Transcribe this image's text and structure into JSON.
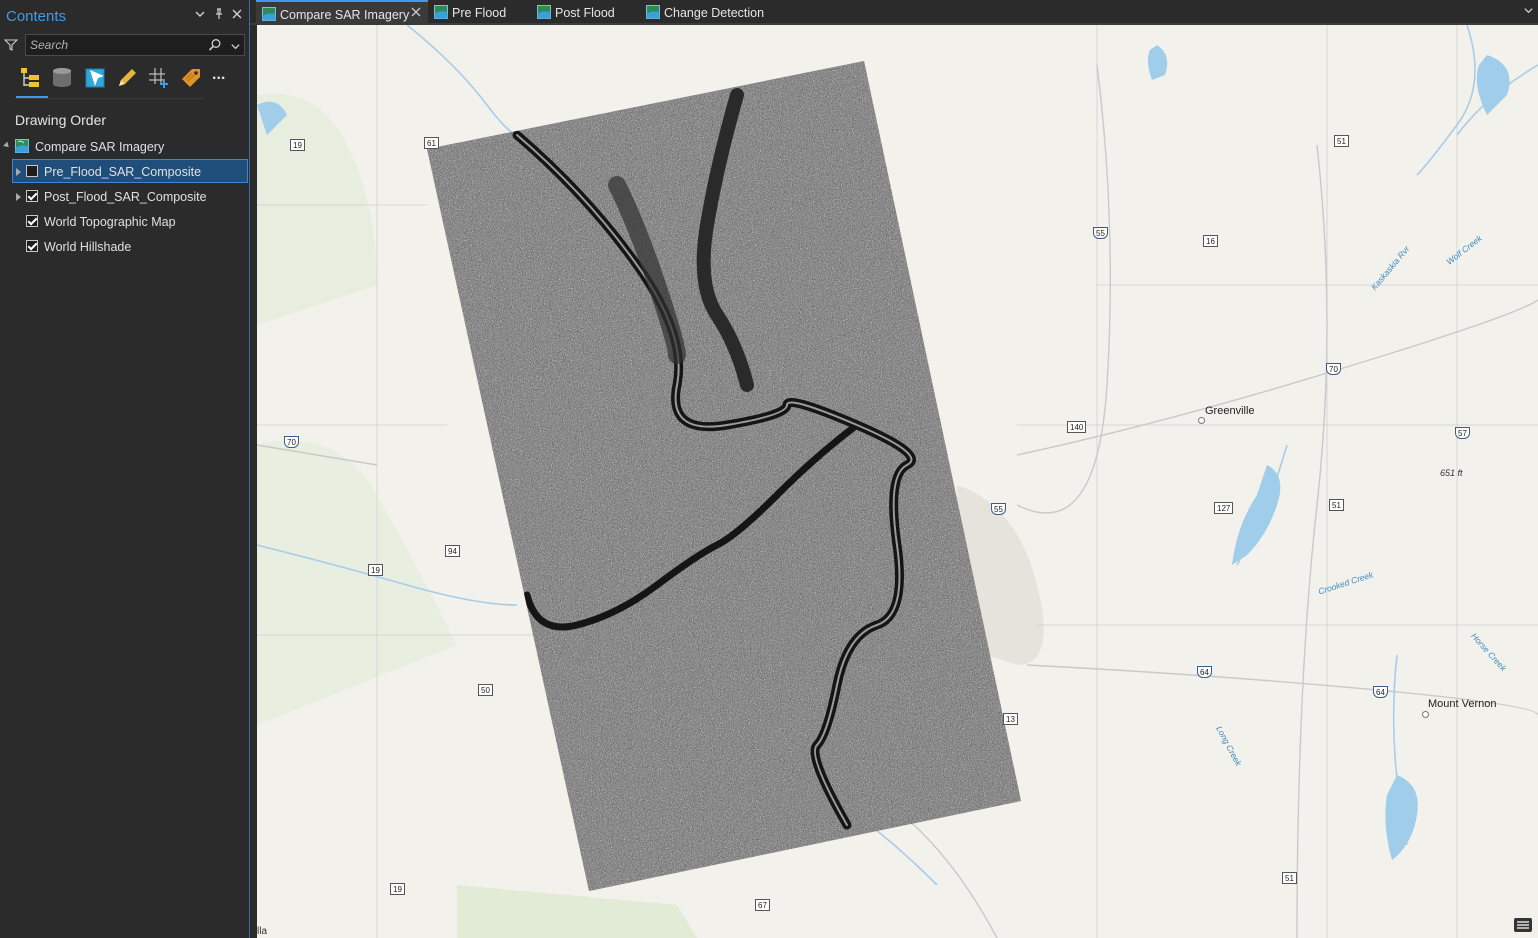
{
  "contents_pane": {
    "title": "Contents",
    "search": {
      "placeholder": "Search"
    },
    "drawing_order_title": "Drawing Order",
    "layers": [
      {
        "label": "Compare SAR Imagery",
        "kind": "map",
        "expanded": true
      },
      {
        "label": "Pre_Flood_SAR_Composite",
        "checked": false,
        "selected": true
      },
      {
        "label": "Post_Flood_SAR_Composite",
        "checked": true
      },
      {
        "label": "World Topographic Map",
        "checked": true
      },
      {
        "label": "World Hillshade",
        "checked": true
      }
    ],
    "toolbar_icons": [
      "list-by-drawing-order-icon",
      "list-by-data-source-icon",
      "list-by-selection-icon",
      "list-by-editing-icon",
      "list-by-snapping-icon",
      "list-by-labeling-icon",
      "more-icon"
    ],
    "more_label": "..."
  },
  "tabs": [
    {
      "label": "Compare SAR Imagery",
      "active": true,
      "closable": true
    },
    {
      "label": "Pre Flood"
    },
    {
      "label": "Post Flood"
    },
    {
      "label": "Change Detection"
    }
  ],
  "map": {
    "towns": [
      "Greenville",
      "Mount Vernon"
    ],
    "water_labels": [
      "Kaskaskia Rvr",
      "Wolf Creek",
      "Crooked Creek",
      "Horse Creek",
      "Long Creek"
    ],
    "elevation_label": "651 ft",
    "route_shields": [
      "19",
      "61",
      "55",
      "16",
      "51",
      "70",
      "140",
      "57",
      "94",
      "19",
      "127",
      "51",
      "50",
      "64",
      "64",
      "13",
      "19",
      "67",
      "51",
      "55",
      "70"
    ],
    "attribution": "lla"
  },
  "colors": {
    "accent": "#3d9be9",
    "selected_row": "#1f4e7a",
    "pane_bg": "#2b2b2b",
    "map_bg": "#f3f2ec"
  }
}
